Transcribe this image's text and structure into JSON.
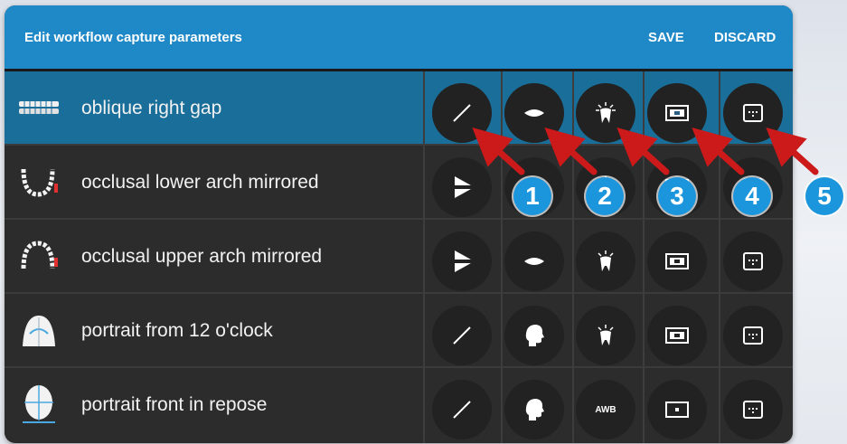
{
  "header": {
    "title": "Edit workflow capture parameters",
    "save_label": "SAVE",
    "discard_label": "DISCARD"
  },
  "rows": [
    {
      "label": "oblique right gap",
      "thumb": "dental-arch-side-icon",
      "selected": true,
      "cells": [
        "line-icon",
        "lips-icon",
        "tooth-light-icon",
        "flash-frame-icon",
        "camera-settings-icon"
      ]
    },
    {
      "label": "occlusal lower arch mirrored",
      "thumb": "lower-arch-icon",
      "selected": false,
      "cells": [
        "mirror-triangle-icon",
        "lips-icon",
        "tooth-light-icon",
        "flash-frame-icon",
        "camera-settings-icon"
      ]
    },
    {
      "label": "occlusal upper arch mirrored",
      "thumb": "upper-arch-icon",
      "selected": false,
      "cells": [
        "mirror-triangle-icon",
        "lips-icon",
        "tooth-light-icon",
        "flash-frame-icon",
        "camera-settings-icon"
      ]
    },
    {
      "label": "portrait from 12 o'clock",
      "thumb": "head-top-icon",
      "selected": false,
      "cells": [
        "line-icon",
        "head-profile-icon",
        "tooth-light-icon",
        "flash-frame-icon",
        "camera-settings-icon"
      ]
    },
    {
      "label": "portrait front in repose",
      "thumb": "head-front-icon",
      "selected": false,
      "cells": [
        "line-icon",
        "head-profile-icon",
        "awb-label",
        "frame-icon",
        "camera-settings-icon"
      ]
    }
  ],
  "awb_text": "AWB",
  "markers": [
    "1",
    "2",
    "3",
    "4",
    "5"
  ],
  "colors": {
    "header": "#1f88c7",
    "selected_row": "#1a6e9a",
    "marker": "#1b95dc",
    "arrow": "#cc1a1a"
  }
}
